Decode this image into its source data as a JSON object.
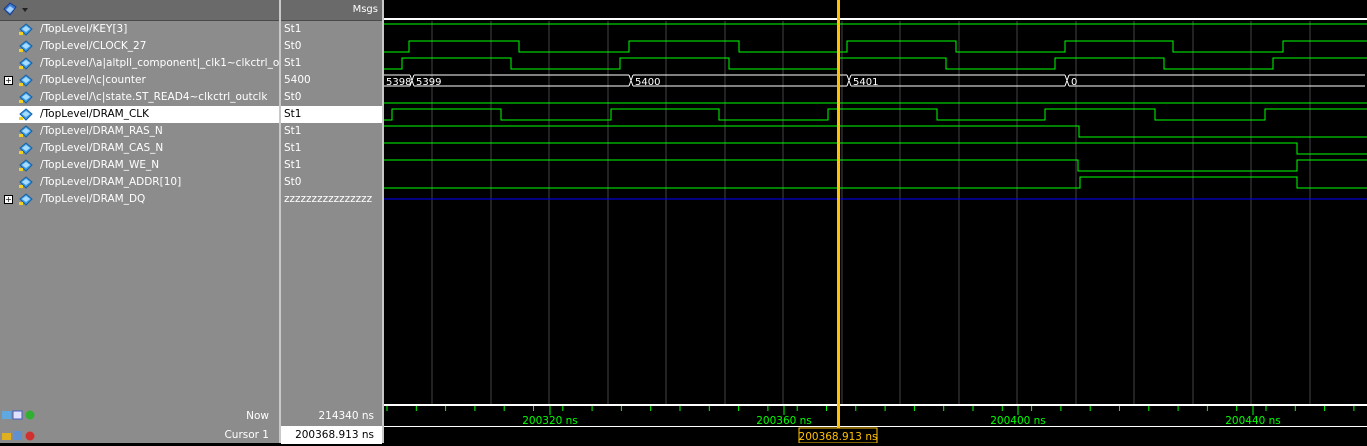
{
  "header": {
    "msgs_label": "Msgs"
  },
  "signals": [
    {
      "name": "/TopLevel/KEY[3]",
      "value": "St1",
      "expandable": false
    },
    {
      "name": "/TopLevel/CLOCK_27",
      "value": "St0",
      "expandable": false
    },
    {
      "name": "/TopLevel/\\a|altpll_component|_clk1~clkctrl_o...",
      "value": "St1",
      "expandable": false
    },
    {
      "name": "/TopLevel/\\c|counter",
      "value": "5400",
      "expandable": true
    },
    {
      "name": "/TopLevel/\\c|state.ST_READ4~clkctrl_outclk",
      "value": "St0",
      "expandable": false
    },
    {
      "name": "/TopLevel/DRAM_CLK",
      "value": "St1",
      "expandable": false,
      "selected": true
    },
    {
      "name": "/TopLevel/DRAM_RAS_N",
      "value": "St1",
      "expandable": false
    },
    {
      "name": "/TopLevel/DRAM_CAS_N",
      "value": "St1",
      "expandable": false
    },
    {
      "name": "/TopLevel/DRAM_WE_N",
      "value": "St1",
      "expandable": false
    },
    {
      "name": "/TopLevel/DRAM_ADDR[10]",
      "value": "St0",
      "expandable": false
    },
    {
      "name": "/TopLevel/DRAM_DQ",
      "value": "zzzzzzzzzzzzzzzz",
      "expandable": true
    }
  ],
  "counter_labels": [
    "5398",
    "5399",
    "5400",
    "5401",
    "0"
  ],
  "footer": {
    "now_label": "Now",
    "now_value": "214340 ns",
    "cursor_label": "Cursor 1",
    "cursor_value": "200368.913 ns",
    "cursor_flag": "200368.913 ns",
    "ticks": [
      "200320 ns",
      "200360 ns",
      "200400 ns",
      "200440 ns"
    ]
  },
  "colors": {
    "wave": "#00ff00",
    "cursor": "#ffc000",
    "zline": "#0000ff",
    "grid": "#444444"
  },
  "icons": {
    "window": "waveform-window-icon",
    "signal": "signal-diamond-icon"
  }
}
